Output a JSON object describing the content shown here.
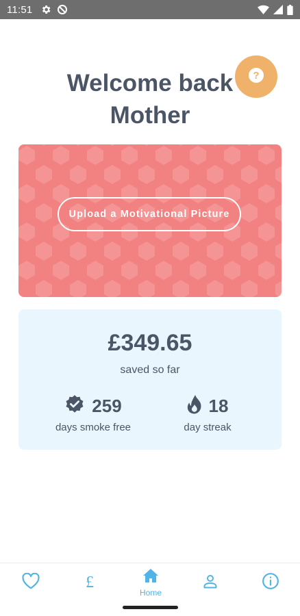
{
  "status_bar": {
    "time": "11:51"
  },
  "header": {
    "title_line1": "Welcome back",
    "title_line2": "Mother"
  },
  "help": {
    "glyph": "?",
    "icon": "question-icon",
    "color": "#f0b26a"
  },
  "motivation": {
    "upload_label": "Upload a Motivational Picture",
    "background_color": "#f28181"
  },
  "stats": {
    "saved_amount": "£349.65",
    "saved_label": "saved so far",
    "smoke_free_days": "259",
    "smoke_free_label": "days smoke free",
    "streak_days": "18",
    "streak_label": "day streak",
    "background_color": "#e9f6fd"
  },
  "nav": {
    "items": [
      {
        "icon": "heart-icon",
        "label": ""
      },
      {
        "icon": "pound-icon",
        "glyph": "£",
        "label": ""
      },
      {
        "icon": "home-icon",
        "label": "Home",
        "active": true
      },
      {
        "icon": "profile-icon",
        "label": ""
      },
      {
        "icon": "info-icon",
        "label": ""
      }
    ],
    "accent_color": "#52b4e6"
  }
}
